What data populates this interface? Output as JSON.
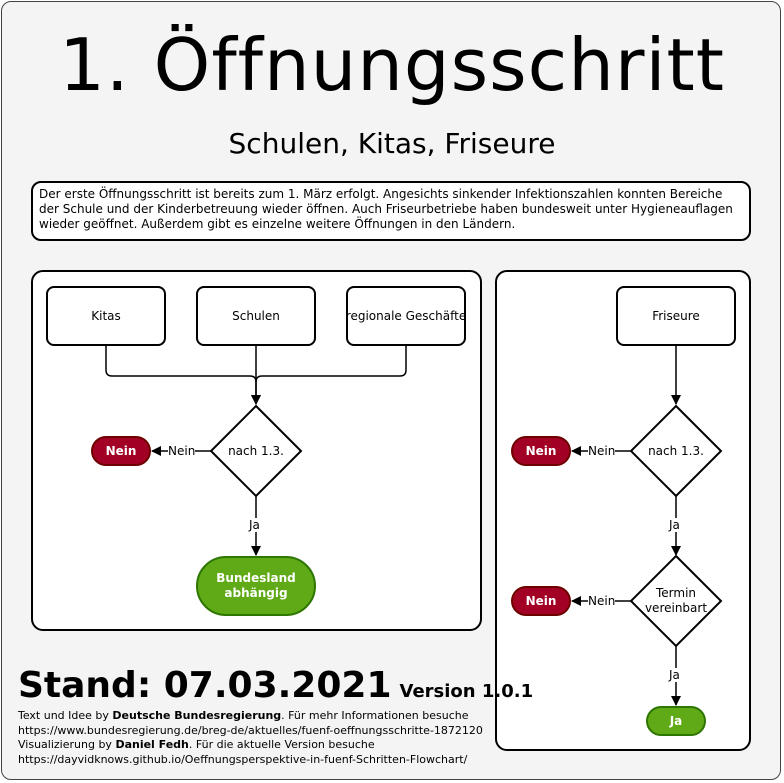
{
  "header": {
    "title": "1. Öffnungsschritt",
    "subtitle": "Schulen, Kitas, Friseure"
  },
  "description": "Der erste Öffnungsschritt ist bereits zum 1. März erfolgt. Angesichts sinkender Infektionszahlen konnten Bereiche der Schule und der Kinderbetreuung wieder öffnen. Auch Friseurbetriebe haben bundesweit unter Hygieneauflagen wieder geöffnet. Außerdem gibt es einzelne weitere Öffnungen in den Ländern.",
  "left_flow": {
    "boxes": [
      "Kitas",
      "Schulen",
      "regionale Geschäfte"
    ],
    "decision": "nach 1.3.",
    "no_edge": "Nein",
    "no_result": "Nein",
    "yes_edge": "Ja",
    "yes_result": "Bundesland abhängig"
  },
  "right_flow": {
    "box": "Friseure",
    "decision1": "nach 1.3.",
    "no_edge1": "Nein",
    "no_result1": "Nein",
    "yes_edge1": "Ja",
    "decision2": "Termin vereinbart",
    "no_edge2": "Nein",
    "no_result2": "Nein",
    "yes_edge2": "Ja",
    "yes_result": "Ja"
  },
  "footer": {
    "stand": "Stand: 07.03.2021",
    "version": "Version 1.0.1",
    "line1_prefix": "Text und Idee by ",
    "line1_author": "Deutsche Bundesregierung",
    "line1_suffix": ". Für mehr Informationen besuche",
    "line2": "https://www.bundesregierung.de/breg-de/aktuelles/fuenf-oeffnungsschritte-1872120",
    "line3_prefix": "Visualizierung by ",
    "line3_author": "Daniel Fedh",
    "line3_suffix": ". Für die aktuelle Version besuche",
    "line4": "https://dayvidknows.github.io/Oeffnungsperspektive-in-fuenf-Schritten-Flowchart/"
  },
  "colors": {
    "no_fill": "#a20025",
    "yes_fill": "#60a917",
    "background": "#f4f4f4"
  }
}
